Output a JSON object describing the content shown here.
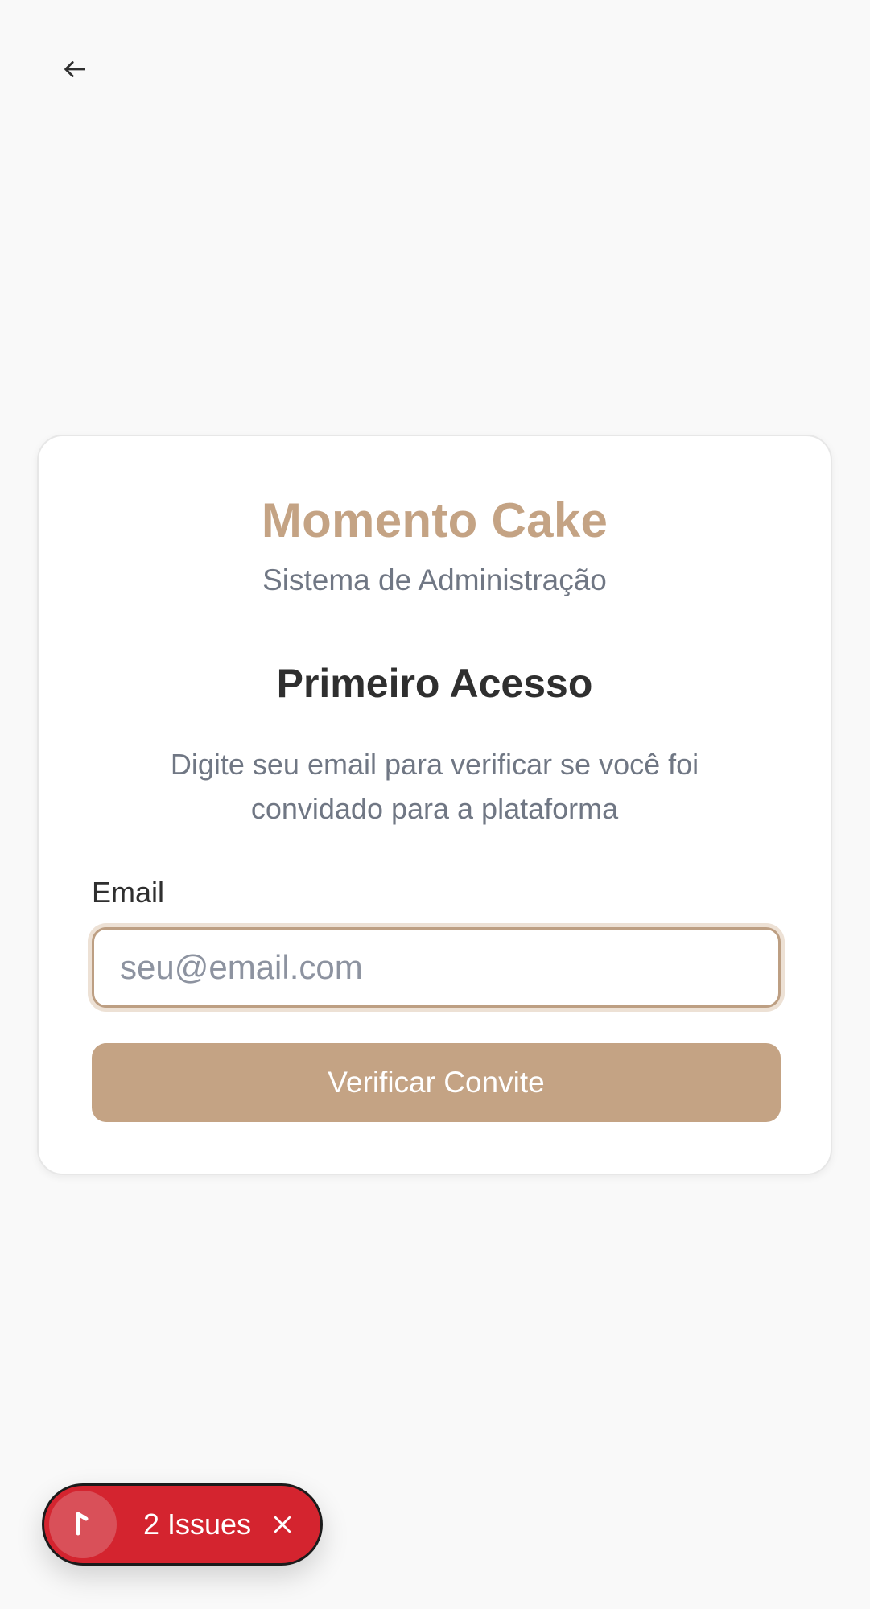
{
  "header": {
    "back_icon": "arrow-left-icon"
  },
  "card": {
    "brand_title": "Momento Cake",
    "brand_subtitle": "Sistema de Administração",
    "heading": "Primeiro Acesso",
    "description": "Digite seu email para verificar se você foi convidado para a plataforma",
    "email_label": "Email",
    "email_value": "",
    "email_placeholder": "seu@email.com",
    "verify_button_label": "Verificar Convite"
  },
  "issues_badge": {
    "label": "2 Issues",
    "indicator_icon": "next-logo-icon",
    "close_icon": "close-icon"
  },
  "colors": {
    "background": "#f9f9f9",
    "brand": "#c4a384",
    "heading_text": "#2f2f2f",
    "muted_text": "#707784",
    "input_border": "#bd9f83",
    "issues_red": "#d4242f"
  }
}
